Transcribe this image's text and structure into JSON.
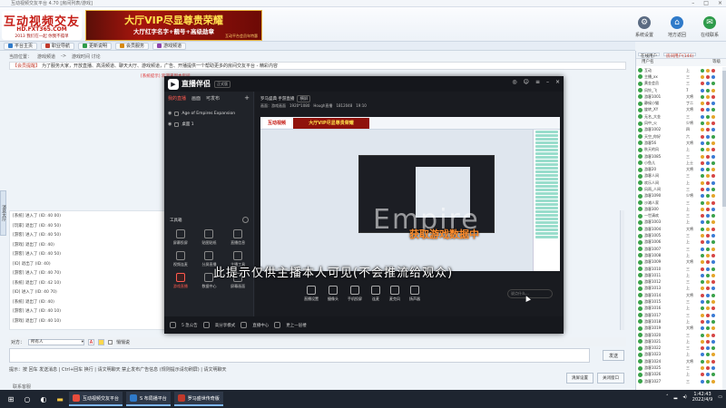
{
  "window": {
    "title": "互动视频交友平台 4.70 [房间列表/游戏]"
  },
  "banner": {
    "logo_text": "互动视频交友",
    "logo_url": "HD.FXT365.COM",
    "logo_slogan": "2013 我们在一起  你我不孤单",
    "ad_title": "大厅VIP尽显尊贵荣耀",
    "ad_subtitle": "大厅红字名字+靓号+高级勋章",
    "ad_footer": "互动平台会员年特惠",
    "icons": [
      {
        "label": "系统设置",
        "icon": "gear-icon",
        "color": "#5b6b82"
      },
      {
        "label": "地方返回",
        "icon": "home-icon",
        "color": "#2f7ac9"
      },
      {
        "label": "在线联系",
        "icon": "chat-icon",
        "color": "#2e9b4a"
      }
    ]
  },
  "tabs": [
    {
      "label": "平台主页",
      "color": "#2f7ac9"
    },
    {
      "label": "职业导航",
      "color": "#c0392b"
    },
    {
      "label": "更新说明",
      "color": "#2e9b4a"
    },
    {
      "label": "会员服务",
      "color": "#d68910"
    },
    {
      "label": "游戏频道",
      "color": "#8e44ad"
    }
  ],
  "path": [
    "当前位置：",
    "游戏频道",
    "->",
    "游戏时间 讨论"
  ],
  "notice": {
    "tag": "【会员提醒】",
    "text": "为了服务大家，开放直播、高清频道、聊天大厅、游戏频道，广告、开播提供一个帮助更多的房间交友平台 - 精彩内容"
  },
  "red_note": "[系统提示] 欢迎来到本房间",
  "left_tab": "消息大厅",
  "chat": [
    "[系统] 进入了 (ID: 40 00)",
    "[玩家] 退出了 (ID: 40 50)",
    "[游客] 进入了 (ID: 40 50)",
    "[游戏] 退出了 (ID: 40)",
    "[游客] 进入了 (ID: 40 50)",
    "[ID] 退出了 (ID: 40)",
    "[游客] 进入了 (ID: 40 70)",
    "[系统] 退出了 (ID: 42 10)",
    "[ID] 进入了 (ID: 40 70)",
    "[系统] 退出了 (ID: 40)",
    "[游客] 进入了 (ID: 40 10)",
    "[游戏] 退出了 (ID: 40 10)"
  ],
  "input": {
    "target_label": "对方：",
    "target_value": "所有人",
    "secret_label": "悄悄说",
    "send_label": "发送"
  },
  "tips": "提示：按 回车 发送消息 | Ctrl+回车 换行 | 请文明聊天 禁止发布广告信息 (规则提示请勿刷屏) | 请文明聊天",
  "buttons": {
    "clear": "清屏设置",
    "close": "关闭窗口"
  },
  "hint": "联系客服",
  "right_panel": {
    "tabs": [
      "在线用户",
      "房间用户(144)"
    ],
    "header": [
      "用户名",
      "等级"
    ],
    "users": [
      {
        "name": "互动",
        "level": "上"
      },
      {
        "name": "主播_xx",
        "level": "三"
      },
      {
        "name": "黄金会员",
        "level": "三"
      },
      {
        "name": "风铃_飞",
        "level": "7"
      },
      {
        "name": "游客1001",
        "level": "大将"
      },
      {
        "name": "静候小猫",
        "level": "丁二"
      },
      {
        "name": "旋转_XY",
        "level": "大将"
      },
      {
        "name": "无名_大金",
        "level": "三"
      },
      {
        "name": "风中_火",
        "level": "少将"
      },
      {
        "name": "游客1002",
        "level": "四"
      },
      {
        "name": "天空_你好",
        "level": "六"
      },
      {
        "name": "游客56",
        "level": "大将"
      },
      {
        "name": "秋天的风",
        "level": "上"
      },
      {
        "name": "游客1085",
        "level": "三"
      },
      {
        "name": "小鱼儿",
        "level": "上士"
      },
      {
        "name": "游客20",
        "level": "大将"
      },
      {
        "name": "游客人间",
        "level": "三"
      },
      {
        "name": "欢乐人间",
        "level": "上"
      },
      {
        "name": "风雨_人间",
        "level": "三"
      },
      {
        "name": "游客1090",
        "level": "少将"
      },
      {
        "name": "沙滩人家",
        "level": "三"
      },
      {
        "name": "游客300",
        "level": "上"
      },
      {
        "name": "一世清欢",
        "level": "三"
      },
      {
        "name": "游客1003",
        "level": "上"
      },
      {
        "name": "游客1004",
        "level": "大将"
      },
      {
        "name": "游客1005",
        "level": "三"
      },
      {
        "name": "游客1006",
        "level": "上"
      },
      {
        "name": "游客1007",
        "level": "三"
      },
      {
        "name": "游客1008",
        "level": "上"
      },
      {
        "name": "游客1009",
        "level": "大将"
      },
      {
        "name": "游客1010",
        "level": "三"
      },
      {
        "name": "游客1011",
        "level": "上"
      },
      {
        "name": "游客1012",
        "level": "三"
      },
      {
        "name": "游客1013",
        "level": "上"
      },
      {
        "name": "游客1014",
        "level": "大将"
      },
      {
        "name": "游客1015",
        "level": "三"
      },
      {
        "name": "游客1016",
        "level": "上"
      },
      {
        "name": "游客1017",
        "level": "三"
      },
      {
        "name": "游客1018",
        "level": "上"
      },
      {
        "name": "游客1019",
        "level": "大将"
      },
      {
        "name": "游客1020",
        "level": "三"
      },
      {
        "name": "游客1021",
        "level": "上"
      },
      {
        "name": "游客1022",
        "level": "三"
      },
      {
        "name": "游客1023",
        "level": "上"
      },
      {
        "name": "游客1024",
        "level": "大将"
      },
      {
        "name": "游客1025",
        "level": "三"
      },
      {
        "name": "游客1026",
        "level": "上"
      },
      {
        "name": "游客1027",
        "level": "三"
      }
    ]
  },
  "obs": {
    "title": "直播伴侣",
    "version": "正式版",
    "left_tabs": [
      "我的直播",
      "画面",
      "可发布",
      "+"
    ],
    "sources": [
      "Age of Empires Expansion",
      "桌面 1"
    ],
    "toolbox_title": "工具箱",
    "tools": [
      "屏幕投屏",
      "贴图贴纸",
      "直播信息",
      "视频连麦",
      "分屏直播",
      "主播工具",
      "游戏直播",
      "数据中心",
      "屏幕画面"
    ],
    "bottom": [
      "5 急公告",
      "高分享模式",
      "直播中心",
      "更上一层楼"
    ],
    "scene_name": "罗马盛典 手游直播",
    "scene_tag": "横屏",
    "info": [
      "画面：游戏画面",
      "1920*1080",
      "Hough直播",
      "1812048",
      "19:10"
    ],
    "preview_logo": "互动视频",
    "preview_ad": "大厅VIP尽显尊贵荣耀",
    "watermark": "Empire",
    "status_text": "获取游戏数据中",
    "controls": [
      "直播设置",
      "摄像头",
      "手机投屏",
      "连麦",
      "麦克风",
      "扬声器"
    ],
    "live_input": "说点什么..."
  },
  "overlay_text": "此提示仅供主播本人可见(不会推流给观众)",
  "taskbar": {
    "apps": [
      {
        "label": "互动视频交友平台",
        "color": "#e74c3c"
      },
      {
        "label": "S 布局播平台",
        "color": "#2f7ac9"
      },
      {
        "label": "罗马盛世传奇版",
        "color": "#c0392b"
      }
    ],
    "time": "1:42:43",
    "date": "2022/4/9"
  }
}
